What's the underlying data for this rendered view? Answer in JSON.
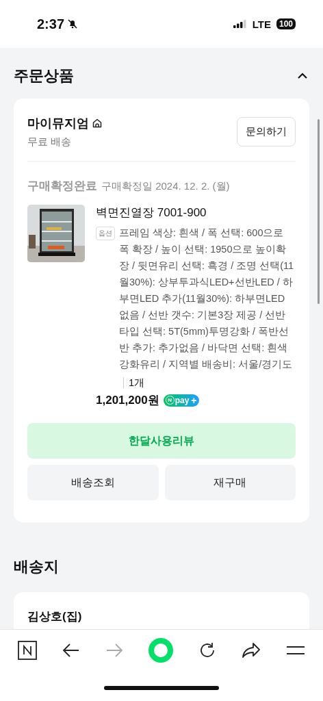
{
  "status_bar": {
    "time": "2:37",
    "network": "LTE",
    "battery": "100"
  },
  "order_section": {
    "title": "주문상품",
    "expanded": true,
    "store": {
      "name": "마이뮤지엄",
      "shipping": "무료 배송",
      "inquiry_button": "문의하기"
    },
    "order": {
      "status": "구매확정완료",
      "confirm_date": "구매확정일 2024. 12. 2. (월)",
      "product": {
        "name": "벽면진열장 7001-900",
        "option_tag": "옵션",
        "options": "프레임 색상: 흰색 / 폭 선택: 600으로 폭 확장 / 높이 선택: 1950으로 높이확장 / 뒷면유리 선택: 흑경 / 조명 선택(11월30%): 상부투과식LED+선반LED / 하부면LED 추가(11월30%): 하부면LED 없음 / 선반 갯수: 기본3장 제공 / 선반타입 선택: 5T(5mm)투명강화 / 폭반선반 추가: 추가없음 / 바닥면 선택: 흰색강화유리 / 지역별 배송비: 서울/경기도",
        "quantity": "1개",
        "price": "1,201,200원",
        "pay_badge": {
          "logo": "N",
          "text": "pay",
          "plus": "+"
        }
      }
    },
    "buttons": [
      {
        "label": "한달사용리뷰",
        "kind": "primary"
      },
      {
        "label": "배송조회",
        "kind": "secondary"
      },
      {
        "label": "재구매",
        "kind": "secondary"
      }
    ]
  },
  "delivery_section": {
    "title": "배송지",
    "recipient": "김상호(집)"
  },
  "bottom_nav": [
    {
      "kind": "logo",
      "disabled": false
    },
    {
      "kind": "back",
      "disabled": false
    },
    {
      "kind": "forward",
      "disabled": true
    },
    {
      "kind": "home",
      "disabled": false
    },
    {
      "kind": "refresh",
      "disabled": false
    },
    {
      "kind": "share",
      "disabled": false
    },
    {
      "kind": "menu",
      "disabled": false
    }
  ]
}
